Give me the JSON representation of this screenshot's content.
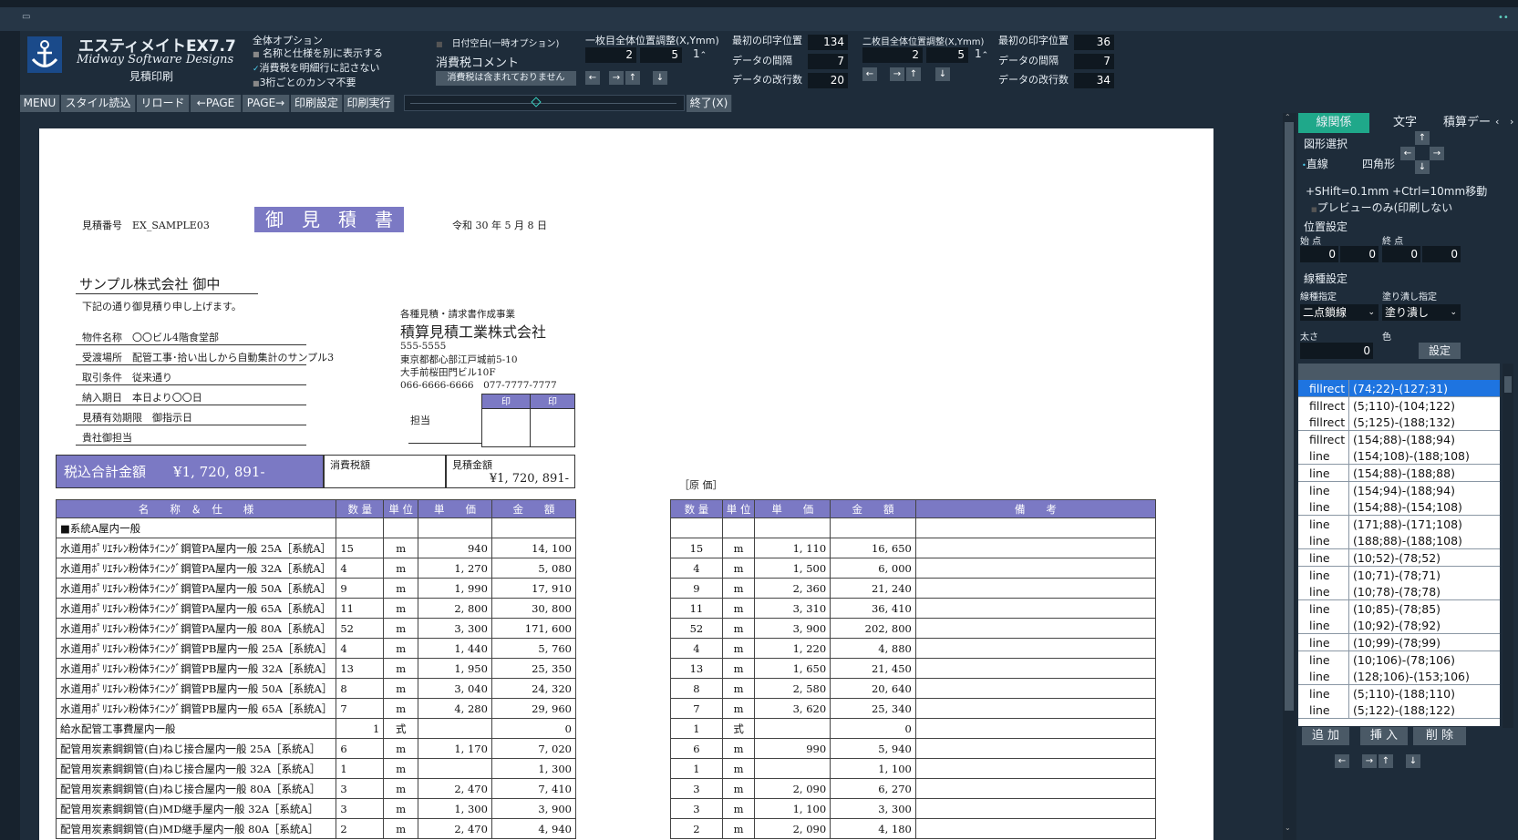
{
  "app": {
    "title": "エスティメイトEX7.7",
    "company": "Midway Software Designs",
    "mode": "見積印刷",
    "window_icon": "app-icon"
  },
  "header": {
    "options_title": "全体オプション",
    "options": [
      {
        "label": "名称と仕様を別に表示する",
        "checked": false
      },
      {
        "label": "消費税を明細行に記さない",
        "checked": true
      },
      {
        "label": "3桁ごとのカンマ不要",
        "checked": false
      }
    ],
    "date_blank": "日付空白(一時オプション)",
    "tax_comment_label": "消費税コメント",
    "tax_comment_value": "消費税は含まれておりません",
    "page1_adjust": "一枚目全体位置調整(X,Ymm)",
    "page1_x": "2",
    "page1_y": "5",
    "page1_spin": "1",
    "first_print_pos_label": "最初の印字位置",
    "first_print_pos_1": "134",
    "data_interval_label": "データの間隔",
    "data_interval_1": "7",
    "data_lines_label": "データの改行数",
    "data_lines_1": "20",
    "page2_adjust": "二枚目全体位置調整(X,Ymm)",
    "page2_x": "2",
    "page2_y": "5",
    "page2_spin": "1",
    "first_print_pos_2": "36",
    "data_interval_2": "7",
    "data_lines_2": "34",
    "arrows": [
      "←",
      "→",
      "↑",
      "↓"
    ]
  },
  "menu": {
    "items": [
      "MENU",
      "スタイル読込",
      "リロード",
      "←PAGE",
      "PAGE→",
      "印刷設定",
      "印刷実行"
    ],
    "exit": "終了(X)"
  },
  "doc": {
    "number_label": "見積番号",
    "number": "EX_SAMPLE03",
    "title": "御　見　積　書",
    "date": "令和 30 年  5 月  8 日",
    "customer": "サンプル株式会社 御中",
    "intro": "下記の通り御見積り申し上げます。",
    "fields": [
      {
        "label": "物件名称",
        "value": "〇〇ビル4階食堂部"
      },
      {
        "label": "受渡場所",
        "value": "配管工事･拾い出しから自動集計のサンプル3"
      },
      {
        "label": "取引条件",
        "value": "従来通り"
      },
      {
        "label": "納入期日",
        "value": "本日より〇〇日"
      },
      {
        "label": "見積有効期限",
        "value": "御指示日"
      },
      {
        "label": "貴社御担当",
        "value": ""
      }
    ],
    "issuer_business": "各種見積・請求書作成事業",
    "issuer_name": "積算見積工業株式会社",
    "issuer_zip": "555-5555",
    "issuer_addr1": "東京都都心部江戸城前5-10",
    "issuer_addr2": "大手前桜田門ビル10F",
    "issuer_tel": "066-6666-6666",
    "issuer_fax": "077-7777-7777",
    "stamp_labels": [
      "印",
      "印"
    ],
    "tanto": "担当",
    "total_label": "税込合計金額",
    "total_value": "¥1, 720, 891-",
    "tax_label": "消費税額",
    "est_label": "見積金額",
    "est_value": "¥1, 720, 891-",
    "genka": "［原 価］",
    "cols_left": [
      "名　　称　＆　仕　　様",
      "数 量",
      "単 位",
      "単　　価",
      "金　　額"
    ],
    "cols_right": [
      "数 量",
      "単 位",
      "単　　価",
      "金　　額",
      "備　　考"
    ],
    "rows": [
      {
        "name": "■系統A屋内一般",
        "qty": "",
        "unit": "",
        "price": "",
        "amount": "",
        "cqty": "",
        "cunit": "",
        "cprice": "",
        "camount": ""
      },
      {
        "name": "水道用ﾎﾟﾘｴﾁﾚﾝ粉体ﾗｲﾆﾝｸﾞ鋼管PA屋内一般 25A［系統A］",
        "qty": "15",
        "unit": "m",
        "price": "940",
        "amount": "14, 100",
        "cqty": "15",
        "cunit": "m",
        "cprice": "1, 110",
        "camount": "16, 650"
      },
      {
        "name": "水道用ﾎﾟﾘｴﾁﾚﾝ粉体ﾗｲﾆﾝｸﾞ鋼管PA屋内一般 32A［系統A］",
        "qty": "4",
        "unit": "m",
        "price": "1, 270",
        "amount": "5, 080",
        "cqty": "4",
        "cunit": "m",
        "cprice": "1, 500",
        "camount": "6, 000"
      },
      {
        "name": "水道用ﾎﾟﾘｴﾁﾚﾝ粉体ﾗｲﾆﾝｸﾞ鋼管PA屋内一般 50A［系統A］",
        "qty": "9",
        "unit": "m",
        "price": "1, 990",
        "amount": "17, 910",
        "cqty": "9",
        "cunit": "m",
        "cprice": "2, 360",
        "camount": "21, 240"
      },
      {
        "name": "水道用ﾎﾟﾘｴﾁﾚﾝ粉体ﾗｲﾆﾝｸﾞ鋼管PA屋内一般 65A［系統A］",
        "qty": "11",
        "unit": "m",
        "price": "2, 800",
        "amount": "30, 800",
        "cqty": "11",
        "cunit": "m",
        "cprice": "3, 310",
        "camount": "36, 410"
      },
      {
        "name": "水道用ﾎﾟﾘｴﾁﾚﾝ粉体ﾗｲﾆﾝｸﾞ鋼管PA屋内一般 80A［系統A］",
        "qty": "52",
        "unit": "m",
        "price": "3, 300",
        "amount": "171, 600",
        "cqty": "52",
        "cunit": "m",
        "cprice": "3, 900",
        "camount": "202, 800"
      },
      {
        "name": "水道用ﾎﾟﾘｴﾁﾚﾝ粉体ﾗｲﾆﾝｸﾞ鋼管PB屋内一般 25A［系統A］",
        "qty": "4",
        "unit": "m",
        "price": "1, 440",
        "amount": "5, 760",
        "cqty": "4",
        "cunit": "m",
        "cprice": "1, 220",
        "camount": "4, 880"
      },
      {
        "name": "水道用ﾎﾟﾘｴﾁﾚﾝ粉体ﾗｲﾆﾝｸﾞ鋼管PB屋内一般 32A［系統A］",
        "qty": "13",
        "unit": "m",
        "price": "1, 950",
        "amount": "25, 350",
        "cqty": "13",
        "cunit": "m",
        "cprice": "1, 650",
        "camount": "21, 450"
      },
      {
        "name": "水道用ﾎﾟﾘｴﾁﾚﾝ粉体ﾗｲﾆﾝｸﾞ鋼管PB屋内一般 50A［系統A］",
        "qty": "8",
        "unit": "m",
        "price": "3, 040",
        "amount": "24, 320",
        "cqty": "8",
        "cunit": "m",
        "cprice": "2, 580",
        "camount": "20, 640"
      },
      {
        "name": "水道用ﾎﾟﾘｴﾁﾚﾝ粉体ﾗｲﾆﾝｸﾞ鋼管PB屋内一般 65A［系統A］",
        "qty": "7",
        "unit": "m",
        "price": "4, 280",
        "amount": "29, 960",
        "cqty": "7",
        "cunit": "m",
        "cprice": "3, 620",
        "camount": "25, 340"
      },
      {
        "name": "給水配管工事費屋内一般",
        "qty": "1",
        "unit": "式",
        "price": "",
        "amount": "0",
        "cqty": "1",
        "cunit": "式",
        "cprice": "",
        "camount": "0"
      },
      {
        "name": "配管用炭素鋼鋼管(白)ねじ接合屋内一般 25A［系統A］",
        "qty": "6",
        "unit": "m",
        "price": "1, 170",
        "amount": "7, 020",
        "cqty": "6",
        "cunit": "m",
        "cprice": "990",
        "camount": "5, 940"
      },
      {
        "name": "配管用炭素鋼鋼管(白)ねじ接合屋内一般 32A［系統A］",
        "qty": "1",
        "unit": "m",
        "price": "",
        "amount": "1, 300",
        "cqty": "1",
        "cunit": "m",
        "cprice": "",
        "camount": "1, 100"
      },
      {
        "name": "配管用炭素鋼鋼管(白)ねじ接合屋内一般 80A［系統A］",
        "qty": "3",
        "unit": "m",
        "price": "2, 470",
        "amount": "7, 410",
        "cqty": "3",
        "cunit": "m",
        "cprice": "2, 090",
        "camount": "6, 270"
      },
      {
        "name": "配管用炭素鋼鋼管(白)MD継手屋内一般 32A［系統A］",
        "qty": "3",
        "unit": "m",
        "price": "1, 300",
        "amount": "3, 900",
        "cqty": "3",
        "cunit": "m",
        "cprice": "1, 100",
        "camount": "3, 300"
      },
      {
        "name": "配管用炭素鋼鋼管(白)MD継手屋内一般 80A［系統A］",
        "qty": "2",
        "unit": "m",
        "price": "2, 470",
        "amount": "4, 940",
        "cqty": "2",
        "cunit": "m",
        "cprice": "2, 090",
        "camount": "4, 180"
      }
    ]
  },
  "sidebar": {
    "tabs": [
      "線関係",
      "文字",
      "積算デー"
    ],
    "shape_select": "図形選択",
    "shape_line": "直線",
    "shape_rect": "四角形",
    "move_hint": "+SHift=0.1mm +Ctrl=10mm移動",
    "preview_only": "プレビューのみ(印刷しない",
    "position_title": "位置設定",
    "start_label": "始 点",
    "end_label": "終 点",
    "pos_values": [
      "0",
      "0",
      "0",
      "0"
    ],
    "linetype_title": "線種設定",
    "linetype_label": "線種指定",
    "fill_label": "塗り潰し指定",
    "linetype_value": "二点鎖線",
    "fill_value": "塗り潰し",
    "thickness_label": "太さ",
    "color_label": "色",
    "thickness_value": "0",
    "set_button": "設定",
    "list": [
      {
        "type": "fillrect",
        "coords": "(74;22)-(127;31)"
      },
      {
        "type": "fillrect",
        "coords": "(5;110)-(104;122)"
      },
      {
        "type": "fillrect",
        "coords": "(5;125)-(188;132)"
      },
      {
        "type": "fillrect",
        "coords": "(154;88)-(188;94)"
      },
      {
        "type": "line",
        "coords": "(154;108)-(188;108)"
      },
      {
        "type": "line",
        "coords": "(154;88)-(188;88)"
      },
      {
        "type": "line",
        "coords": "(154;94)-(188;94)"
      },
      {
        "type": "line",
        "coords": "(154;88)-(154;108)"
      },
      {
        "type": "line",
        "coords": "(171;88)-(171;108)"
      },
      {
        "type": "line",
        "coords": "(188;88)-(188;108)"
      },
      {
        "type": "line",
        "coords": "(10;52)-(78;52)"
      },
      {
        "type": "line",
        "coords": "(10;71)-(78;71)"
      },
      {
        "type": "line",
        "coords": "(10;78)-(78;78)"
      },
      {
        "type": "line",
        "coords": "(10;85)-(78;85)"
      },
      {
        "type": "line",
        "coords": "(10;92)-(78;92)"
      },
      {
        "type": "line",
        "coords": "(10;99)-(78;99)"
      },
      {
        "type": "line",
        "coords": "(10;106)-(78;106)"
      },
      {
        "type": "line",
        "coords": "(128;106)-(153;106)"
      },
      {
        "type": "line",
        "coords": "(5;110)-(188;110)"
      },
      {
        "type": "line",
        "coords": "(5;122)-(188;122)"
      }
    ],
    "add": "追 加",
    "insert": "挿 入",
    "delete": "削 除"
  },
  "colors": {
    "accent": "#7b79c4",
    "tab_active": "#1fa88a",
    "selected": "#1e74e0"
  }
}
